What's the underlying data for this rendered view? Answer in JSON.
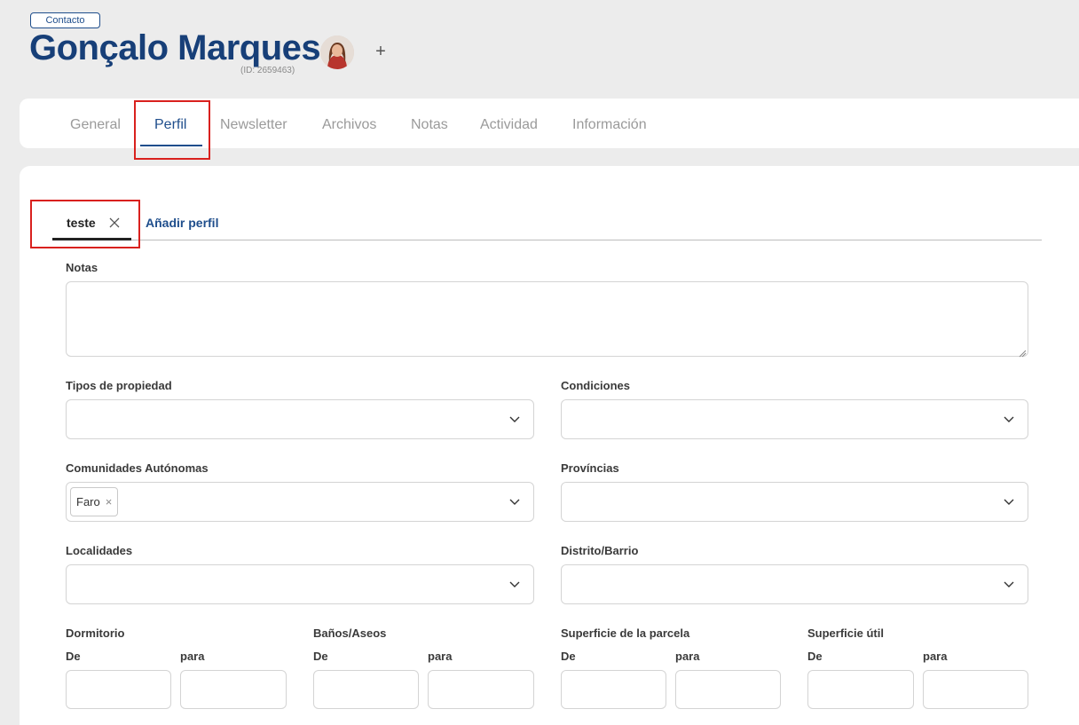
{
  "header": {
    "badge": "Contacto",
    "name": "Gonçalo Marques",
    "id": "(ID: 2659463)",
    "add_symbol": "+"
  },
  "tabs": [
    {
      "label": "General"
    },
    {
      "label": "Perfil",
      "active": true
    },
    {
      "label": "Newsletter"
    },
    {
      "label": "Archivos"
    },
    {
      "label": "Notas"
    },
    {
      "label": "Actividad"
    },
    {
      "label": "Información"
    }
  ],
  "profiles": {
    "active": "teste",
    "add_label": "Añadir perfil"
  },
  "form": {
    "notes_label": "Notas",
    "notes_value": "",
    "property_types_label": "Tipos de propiedad",
    "conditions_label": "Condiciones",
    "communities_label": "Comunidades Autónomas",
    "communities_selected": "Faro",
    "chip_remove": "×",
    "provinces_label": "Províncias",
    "localities_label": "Localidades",
    "district_label": "Distrito/Barrio",
    "bedrooms_label": "Dormitorio",
    "bathrooms_label": "Baños/Aseos",
    "plot_area_label": "Superficie de la parcela",
    "useful_area_label": "Superficie útil",
    "from_label": "De",
    "to_label": "para"
  },
  "colors": {
    "brand": "#1f4e8c",
    "highlight": "#d9211e",
    "background": "#ececec"
  },
  "icons": {
    "close": "close-icon",
    "dropdown": "chevron-down-icon",
    "add": "plus-icon"
  }
}
